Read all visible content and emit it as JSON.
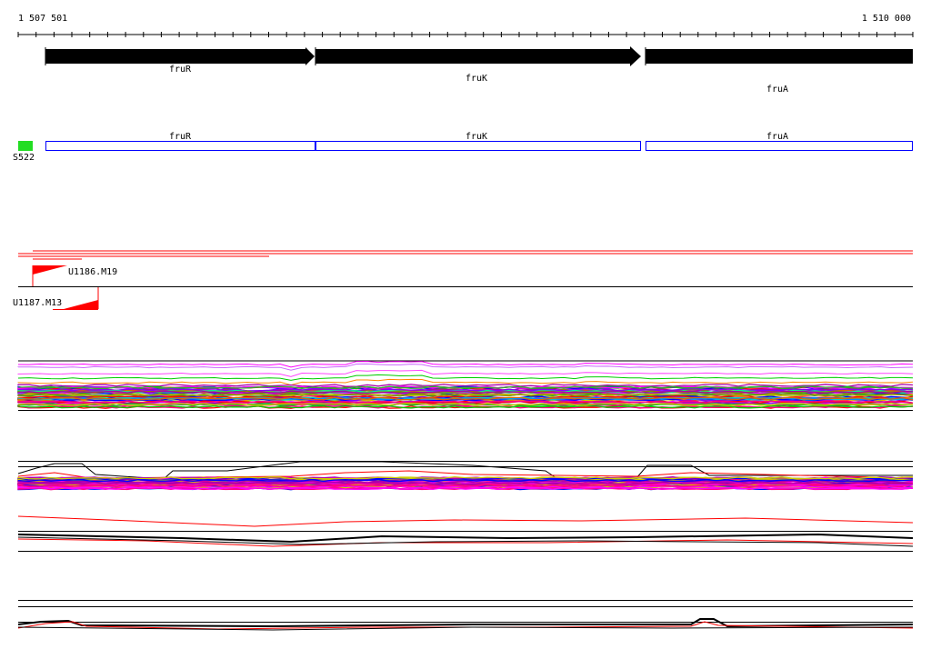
{
  "ruler": {
    "start_label": "1 507 501",
    "end_label": "1 510 000"
  },
  "genes": [
    {
      "name": "fruR"
    },
    {
      "name": "fruK"
    },
    {
      "name": "fruA"
    }
  ],
  "orf_boxes": [
    {
      "name": "fruR"
    },
    {
      "name": "fruK"
    },
    {
      "name": "fruA"
    }
  ],
  "feature_marker": {
    "label": "S522",
    "color": "#22dd22"
  },
  "reads": [
    {
      "label": "U1186.M19",
      "strand": "forward"
    },
    {
      "label": "U1187.M13",
      "strand": "reverse"
    }
  ],
  "colors": {
    "gene_arrow": "#000000",
    "orf_box": "#0000ff",
    "read": "#ff0000",
    "track_line": "#000000"
  }
}
